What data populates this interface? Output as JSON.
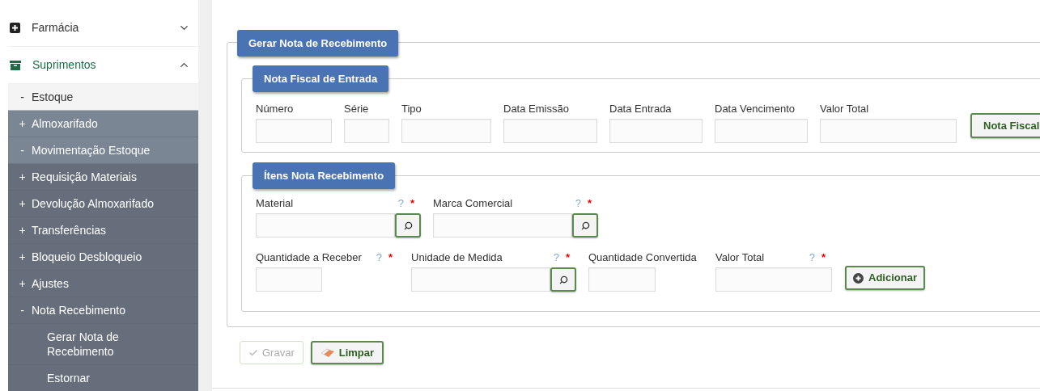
{
  "sidebar": {
    "sections": [
      {
        "label": "Farmácia",
        "expanded": false
      },
      {
        "label": "Suprimentos",
        "expanded": true,
        "items": [
          {
            "marker": "-",
            "label": "Estoque",
            "children": [
              {
                "marker": "+",
                "label": "Almoxarifado"
              },
              {
                "marker": "-",
                "label": "Movimentação Estoque",
                "children": [
                  {
                    "marker": "+",
                    "label": "Requisição Materiais"
                  },
                  {
                    "marker": "+",
                    "label": "Devolução Almoxarifado"
                  },
                  {
                    "marker": "+",
                    "label": "Transferências"
                  },
                  {
                    "marker": "+",
                    "label": "Bloqueio Desbloqueio"
                  },
                  {
                    "marker": "+",
                    "label": "Ajustes"
                  },
                  {
                    "marker": "-",
                    "label": "Nota Recebimento",
                    "children": [
                      {
                        "label": "Gerar Nota de Recebimento"
                      },
                      {
                        "label": "Estornar"
                      }
                    ]
                  }
                ]
              }
            ]
          }
        ]
      }
    ]
  },
  "form": {
    "legend": "Gerar Nota de Recebimento",
    "invoice": {
      "legend": "Nota Fiscal de Entrada",
      "fields": [
        {
          "label": "Número"
        },
        {
          "label": "Série"
        },
        {
          "label": "Tipo"
        },
        {
          "label": "Data Emissão"
        },
        {
          "label": "Data Entrada"
        },
        {
          "label": "Data Vencimento"
        },
        {
          "label": "Valor Total"
        }
      ],
      "button": "Nota Fiscal"
    },
    "items": {
      "legend": "Ítens Nota Recebimento",
      "rows": [
        [
          {
            "label": "Material",
            "help": "?",
            "required": "*",
            "lookup": true
          },
          {
            "label": "Marca Comercial",
            "help": "?",
            "required": "*",
            "lookup": true
          }
        ],
        [
          {
            "label": "Quantidade a Receber",
            "help": "?",
            "required": "*",
            "lookup": false
          },
          {
            "label": "Unidade de Medida",
            "help": "?",
            "required": "*",
            "lookup": true
          },
          {
            "label": "Quantidade Convertida",
            "lookup": false
          },
          {
            "label": "Valor Total",
            "help": "?",
            "required": "*",
            "lookup": false
          }
        ]
      ],
      "add_button": "Adicionar"
    },
    "actions": [
      {
        "label": "Gravar",
        "kind": "save",
        "disabled": true
      },
      {
        "label": "Limpar",
        "kind": "clear",
        "disabled": false
      }
    ]
  }
}
